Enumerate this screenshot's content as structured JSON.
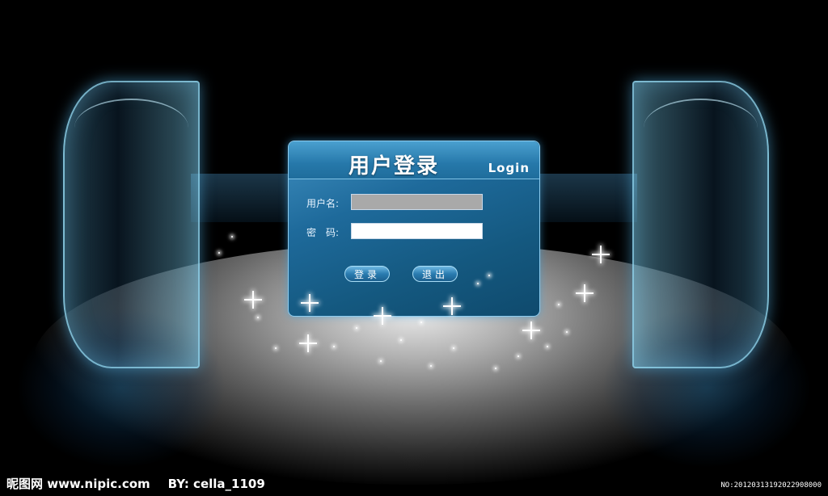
{
  "login": {
    "title": "用户登录",
    "title_en": "Login",
    "username_label": "用户名:",
    "username_value": "",
    "password_label": "密　码:",
    "password_value": "",
    "login_button": "登录",
    "exit_button": "退出"
  },
  "watermark": {
    "site": "昵图网 www.nipic.com",
    "by": "BY: cella_1109",
    "id": "NO:20120313192022908000"
  },
  "colors": {
    "panel": "#1e6a9b",
    "panel_header": "#2678aa",
    "glass": "#5aaad2",
    "background": "#000000"
  }
}
